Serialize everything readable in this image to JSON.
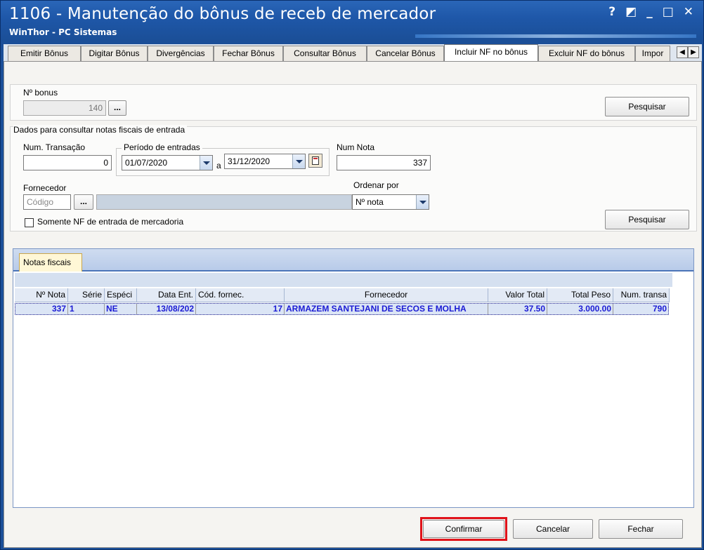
{
  "window": {
    "title": "1106 - Manutenção do bônus de receb de mercador",
    "subtitle": "WinThor - PC Sistemas",
    "controls": [
      "?",
      "◩",
      "_",
      "□",
      "✕"
    ]
  },
  "tabs": [
    {
      "label": "Emitir Bônus",
      "active": false
    },
    {
      "label": "Digitar Bônus",
      "active": false
    },
    {
      "label": "Divergências",
      "active": false
    },
    {
      "label": "Fechar Bônus",
      "active": false
    },
    {
      "label": "Consultar Bônus",
      "active": false
    },
    {
      "label": "Cancelar Bônus",
      "active": false
    },
    {
      "label": "Incluir NF no bônus",
      "active": true
    },
    {
      "label": "Excluir NF do bônus",
      "active": false
    },
    {
      "label": "Impor",
      "active": false
    }
  ],
  "bonus": {
    "label": "Nº bonus",
    "value": "140",
    "ellipsis": "...",
    "search_button": "Pesquisar"
  },
  "filters": {
    "group_label": "Dados para consultar notas fiscais de entrada",
    "transacao_label": "Num. Transação",
    "transacao_value": "0",
    "periodo_label": "Período de entradas",
    "date_from": "01/07/2020",
    "date_sep": "a",
    "date_to": "31/12/2020",
    "num_nota_label": "Num Nota",
    "num_nota_value": "337",
    "fornecedor_label": "Fornecedor",
    "fornecedor_placeholder": "Código",
    "ellipsis": "...",
    "ordenar_label": "Ordenar por",
    "ordenar_value": "Nº nota",
    "somente_label": "Somente NF de entrada de mercadoria",
    "search_button": "Pesquisar"
  },
  "grid": {
    "tab_label": "Notas fiscais",
    "columns": [
      "Nº Nota",
      "Série",
      "Espéci",
      "Data Ent.",
      "Cód. fornec.",
      "Fornecedor",
      "Valor Total",
      "Total Peso",
      "Num. transa"
    ],
    "rows": [
      [
        "337",
        "1",
        "NE",
        "13/08/202",
        "17",
        "ARMAZEM SANTEJANI DE SECOS E MOLHA",
        "37.50",
        "3.000.00",
        "790"
      ]
    ]
  },
  "footer": {
    "confirm": "Confirmar",
    "cancel": "Cancelar",
    "close": "Fechar"
  }
}
